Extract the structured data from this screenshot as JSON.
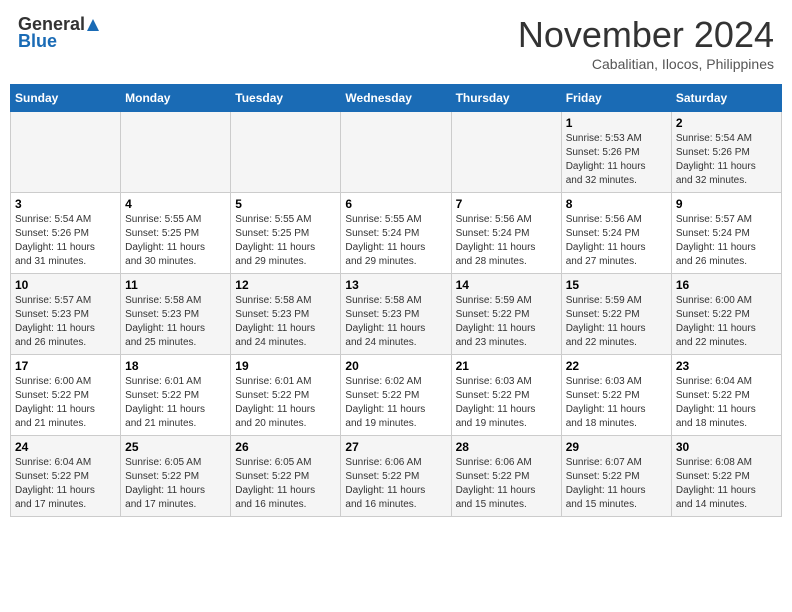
{
  "header": {
    "logo_general": "General",
    "logo_blue": "Blue",
    "month_title": "November 2024",
    "subtitle": "Cabalitian, Ilocos, Philippines"
  },
  "weekdays": [
    "Sunday",
    "Monday",
    "Tuesday",
    "Wednesday",
    "Thursday",
    "Friday",
    "Saturday"
  ],
  "weeks": [
    [
      {
        "day": "",
        "info": ""
      },
      {
        "day": "",
        "info": ""
      },
      {
        "day": "",
        "info": ""
      },
      {
        "day": "",
        "info": ""
      },
      {
        "day": "",
        "info": ""
      },
      {
        "day": "1",
        "info": "Sunrise: 5:53 AM\nSunset: 5:26 PM\nDaylight: 11 hours\nand 32 minutes."
      },
      {
        "day": "2",
        "info": "Sunrise: 5:54 AM\nSunset: 5:26 PM\nDaylight: 11 hours\nand 32 minutes."
      }
    ],
    [
      {
        "day": "3",
        "info": "Sunrise: 5:54 AM\nSunset: 5:26 PM\nDaylight: 11 hours\nand 31 minutes."
      },
      {
        "day": "4",
        "info": "Sunrise: 5:55 AM\nSunset: 5:25 PM\nDaylight: 11 hours\nand 30 minutes."
      },
      {
        "day": "5",
        "info": "Sunrise: 5:55 AM\nSunset: 5:25 PM\nDaylight: 11 hours\nand 29 minutes."
      },
      {
        "day": "6",
        "info": "Sunrise: 5:55 AM\nSunset: 5:24 PM\nDaylight: 11 hours\nand 29 minutes."
      },
      {
        "day": "7",
        "info": "Sunrise: 5:56 AM\nSunset: 5:24 PM\nDaylight: 11 hours\nand 28 minutes."
      },
      {
        "day": "8",
        "info": "Sunrise: 5:56 AM\nSunset: 5:24 PM\nDaylight: 11 hours\nand 27 minutes."
      },
      {
        "day": "9",
        "info": "Sunrise: 5:57 AM\nSunset: 5:24 PM\nDaylight: 11 hours\nand 26 minutes."
      }
    ],
    [
      {
        "day": "10",
        "info": "Sunrise: 5:57 AM\nSunset: 5:23 PM\nDaylight: 11 hours\nand 26 minutes."
      },
      {
        "day": "11",
        "info": "Sunrise: 5:58 AM\nSunset: 5:23 PM\nDaylight: 11 hours\nand 25 minutes."
      },
      {
        "day": "12",
        "info": "Sunrise: 5:58 AM\nSunset: 5:23 PM\nDaylight: 11 hours\nand 24 minutes."
      },
      {
        "day": "13",
        "info": "Sunrise: 5:58 AM\nSunset: 5:23 PM\nDaylight: 11 hours\nand 24 minutes."
      },
      {
        "day": "14",
        "info": "Sunrise: 5:59 AM\nSunset: 5:22 PM\nDaylight: 11 hours\nand 23 minutes."
      },
      {
        "day": "15",
        "info": "Sunrise: 5:59 AM\nSunset: 5:22 PM\nDaylight: 11 hours\nand 22 minutes."
      },
      {
        "day": "16",
        "info": "Sunrise: 6:00 AM\nSunset: 5:22 PM\nDaylight: 11 hours\nand 22 minutes."
      }
    ],
    [
      {
        "day": "17",
        "info": "Sunrise: 6:00 AM\nSunset: 5:22 PM\nDaylight: 11 hours\nand 21 minutes."
      },
      {
        "day": "18",
        "info": "Sunrise: 6:01 AM\nSunset: 5:22 PM\nDaylight: 11 hours\nand 21 minutes."
      },
      {
        "day": "19",
        "info": "Sunrise: 6:01 AM\nSunset: 5:22 PM\nDaylight: 11 hours\nand 20 minutes."
      },
      {
        "day": "20",
        "info": "Sunrise: 6:02 AM\nSunset: 5:22 PM\nDaylight: 11 hours\nand 19 minutes."
      },
      {
        "day": "21",
        "info": "Sunrise: 6:03 AM\nSunset: 5:22 PM\nDaylight: 11 hours\nand 19 minutes."
      },
      {
        "day": "22",
        "info": "Sunrise: 6:03 AM\nSunset: 5:22 PM\nDaylight: 11 hours\nand 18 minutes."
      },
      {
        "day": "23",
        "info": "Sunrise: 6:04 AM\nSunset: 5:22 PM\nDaylight: 11 hours\nand 18 minutes."
      }
    ],
    [
      {
        "day": "24",
        "info": "Sunrise: 6:04 AM\nSunset: 5:22 PM\nDaylight: 11 hours\nand 17 minutes."
      },
      {
        "day": "25",
        "info": "Sunrise: 6:05 AM\nSunset: 5:22 PM\nDaylight: 11 hours\nand 17 minutes."
      },
      {
        "day": "26",
        "info": "Sunrise: 6:05 AM\nSunset: 5:22 PM\nDaylight: 11 hours\nand 16 minutes."
      },
      {
        "day": "27",
        "info": "Sunrise: 6:06 AM\nSunset: 5:22 PM\nDaylight: 11 hours\nand 16 minutes."
      },
      {
        "day": "28",
        "info": "Sunrise: 6:06 AM\nSunset: 5:22 PM\nDaylight: 11 hours\nand 15 minutes."
      },
      {
        "day": "29",
        "info": "Sunrise: 6:07 AM\nSunset: 5:22 PM\nDaylight: 11 hours\nand 15 minutes."
      },
      {
        "day": "30",
        "info": "Sunrise: 6:08 AM\nSunset: 5:22 PM\nDaylight: 11 hours\nand 14 minutes."
      }
    ]
  ]
}
